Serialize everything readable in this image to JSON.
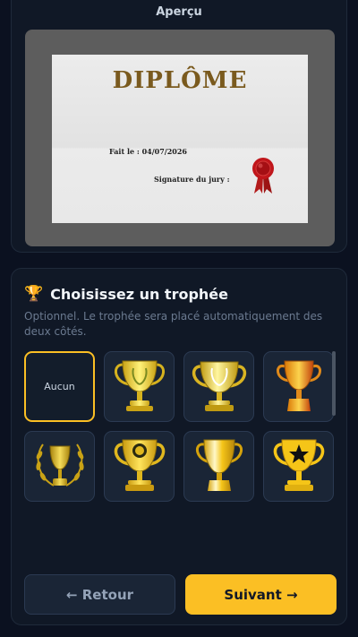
{
  "preview": {
    "title": "Aperçu",
    "diploma": {
      "title": "DIPLÔME",
      "date_line": "Fait le : 04/07/2026",
      "signature_line": "Signature du jury :"
    }
  },
  "trophy_section": {
    "icon": "trophy-icon",
    "heading": "Choisissez un trophée",
    "subtitle": "Optionnel. Le trophée sera placé automatiquement des deux côtés.",
    "options": [
      {
        "label": "Aucun",
        "selected": true
      },
      {
        "icon": "trophy-laurel-handles-icon",
        "selected": false
      },
      {
        "icon": "trophy-laurel-wide-icon",
        "selected": false
      },
      {
        "icon": "trophy-orange-cup-icon",
        "selected": false
      },
      {
        "icon": "trophy-laurel-wreath-icon",
        "selected": false
      },
      {
        "icon": "trophy-medallion-icon",
        "selected": false
      },
      {
        "icon": "trophy-shiny-cup-icon",
        "selected": false
      },
      {
        "icon": "trophy-star-icon",
        "selected": false
      }
    ]
  },
  "footer": {
    "back_label": "← Retour",
    "next_label": "Suivant →"
  },
  "colors": {
    "accent": "#fbbf24",
    "background": "#0b1120",
    "card": "#101826",
    "tile": "#1a2536"
  }
}
